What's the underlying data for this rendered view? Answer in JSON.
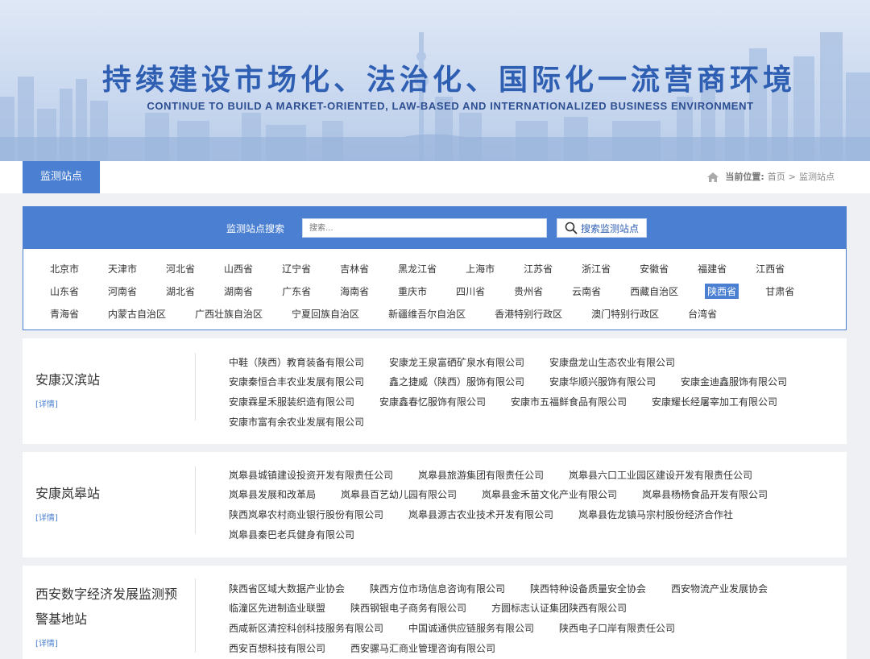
{
  "banner": {
    "title": "持续建设市场化、法治化、国际化一流营商环境",
    "subtitle": "CONTINUE TO BUILD A MARKET-ORIENTED, LAW-BASED AND INTERNATIONALIZED BUSINESS ENVIRONMENT"
  },
  "nav": {
    "tab": "监测站点",
    "breadcrumb_label": "当前位置:",
    "breadcrumb_home": "首页",
    "breadcrumb_sep": ">",
    "breadcrumb_current": "监测站点",
    "accent": "#4a7fd1"
  },
  "search": {
    "label": "监测站点搜索",
    "placeholder": "搜索...",
    "button": "搜索监测站点"
  },
  "regions": [
    [
      "北京市",
      "天津市",
      "河北省",
      "山西省",
      "辽宁省",
      "吉林省",
      "黑龙江省",
      "上海市",
      "江苏省",
      "浙江省",
      "安徽省",
      "福建省",
      "江西省"
    ],
    [
      "山东省",
      "河南省",
      "湖北省",
      "湖南省",
      "广东省",
      "海南省",
      "重庆市",
      "四川省",
      "贵州省",
      "云南省",
      "西藏自治区",
      "陕西省",
      "甘肃省"
    ],
    [
      "青海省",
      "内蒙古自治区",
      "广西壮族自治区",
      "宁夏回族自治区",
      "新疆维吾尔自治区",
      "香港特别行政区",
      "澳门特别行政区",
      "台湾省"
    ]
  ],
  "active_region": "陕西省",
  "stations": [
    {
      "name": "安康汉滨站",
      "detail": "[详情]",
      "companies": [
        [
          "中鞋（陕西）教育装备有限公司",
          "安康龙王泉富硒矿泉水有限公司",
          "安康盘龙山生态农业有限公司"
        ],
        [
          "安康秦恒合丰农业发展有限公司",
          "鑫之捷威（陕西）服饰有限公司",
          "安康华顺兴服饰有限公司",
          "安康金迪鑫服饰有限公司"
        ],
        [
          "安康霖星禾服装织造有限公司",
          "安康鑫春忆服饰有限公司",
          "安康市五福鲜食品有限公司",
          "安康耀长经屠宰加工有限公司"
        ],
        [
          "安康市富有余农业发展有限公司"
        ]
      ]
    },
    {
      "name": "安康岚皋站",
      "detail": "[详情]",
      "companies": [
        [
          "岚皋县城镇建设投资开发有限责任公司",
          "岚皋县旅游集团有限责任公司",
          "岚皋县六口工业园区建设开发有限责任公司"
        ],
        [
          "岚皋县发展和改革局",
          "岚皋县百艺幼儿园有限公司",
          "岚皋县金禾苗文化产业有限公司",
          "岚皋县杨杨食品开发有限公司"
        ],
        [
          "陕西岚皋农村商业银行股份有限公司",
          "岚皋县源古农业技术开发有限公司",
          "岚皋县佐龙镇马宗村股份经济合作社"
        ],
        [
          "岚皋县秦巴老兵健身有限公司"
        ]
      ]
    },
    {
      "name": "西安数字经济发展监测预警基地站",
      "detail": "[详情]",
      "companies": [
        [
          "陕西省区域大数据产业协会",
          "陕西方位市场信息咨询有限公司",
          "陕西特种设备质量安全协会",
          "西安物流产业发展协会"
        ],
        [
          "临潼区先进制造业联盟",
          "陕西钢银电子商务有限公司",
          "方圆标志认证集团陕西有限公司"
        ],
        [
          "西咸新区清控科创科技服务有限公司",
          "中国诚通供应链服务有限公司",
          "陕西电子口岸有限责任公司"
        ],
        [
          "西安百想科技有限公司",
          "西安骡马汇商业管理咨询有限公司"
        ]
      ]
    }
  ]
}
